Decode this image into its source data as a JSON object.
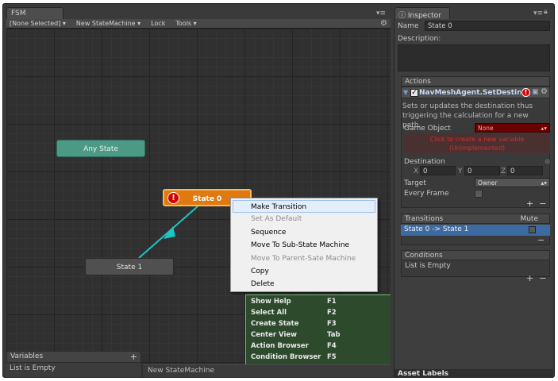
{
  "fsm_panel": {
    "tab_title": "FSM",
    "menu_icon": "tab-menu-icon",
    "toolbar": {
      "selection": "[None Selected]",
      "selection_arrow": "▾",
      "fsm_name": "New StateMachine",
      "fsm_arrow": "▾",
      "lock": "Lock",
      "tools": "Tools",
      "tools_arrow": "▾"
    }
  },
  "states": {
    "any_state": "Any State",
    "state_0": "State 0",
    "state_1": "State 1",
    "error_symbol": "!"
  },
  "context_menu": {
    "items": [
      {
        "label": "Make Transition",
        "enabled": true,
        "highlighted": true
      },
      {
        "label": "Set As Default",
        "enabled": false
      },
      {
        "label": "Sequence",
        "enabled": true
      },
      {
        "label": "Move To Sub-State Machine",
        "enabled": true
      },
      {
        "label": "Move To Parent-Sate Machine",
        "enabled": false
      },
      {
        "label": "Copy",
        "enabled": true
      },
      {
        "label": "Delete",
        "enabled": true
      }
    ]
  },
  "shortcuts": [
    {
      "label": "Show Help",
      "key": "F1"
    },
    {
      "label": "Select All",
      "key": "F2"
    },
    {
      "label": "Create State",
      "key": "F3"
    },
    {
      "label": "Center View",
      "key": "Tab"
    },
    {
      "label": "Action Browser",
      "key": "F4"
    },
    {
      "label": "Condition Browser",
      "key": "F5"
    }
  ],
  "variables": {
    "title": "Variables",
    "add": "+",
    "empty_text": "List is Empty"
  },
  "footer_fsm_name": "New StateMachine",
  "inspector": {
    "tab_title": "Inspector",
    "tab_icon": "info-icon",
    "name_label": "Name",
    "name_value": "State 0",
    "description_label": "Description:",
    "actions_header": "Actions",
    "action": {
      "title": "NavMeshAgent.SetDestination",
      "checkbox": "✓",
      "description": "Sets or updates the destination thus triggering the calculation for a new path.",
      "game_object_label": "Game Object",
      "game_object_value": "None",
      "error_text": "Click to create a new variable (Unimplemented)",
      "destination_label": "Destination",
      "x_label": "X",
      "x_value": "0",
      "y_label": "Y",
      "y_value": "0",
      "z_label": "Z",
      "z_value": "0",
      "target_label": "Target",
      "target_value": "Owner",
      "every_frame_label": "Every Frame"
    },
    "add_btn": "+",
    "remove_btn": "−",
    "transitions_header": "Transitions",
    "mute_label": "Mute",
    "transition_row": "State 0 -> State 1",
    "conditions_header": "Conditions",
    "conditions_empty": "List is Empty",
    "asset_labels": "Asset Labels"
  },
  "colors": {
    "state0": "#e07a10",
    "any_state": "#4c9a86",
    "transition_arrow": "#1ec4c4",
    "selection": "#3d6aa0",
    "error_red": "#d20000"
  }
}
